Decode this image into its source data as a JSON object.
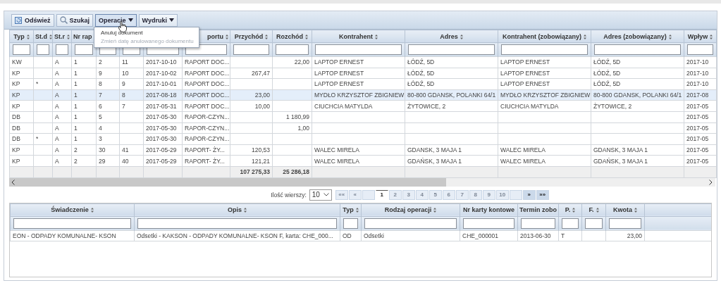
{
  "toolbar": {
    "buttons": [
      {
        "label": "Odśwież",
        "kind": "refresh"
      },
      {
        "label": "Szukaj",
        "kind": "search"
      },
      {
        "label": "Operacje",
        "kind": "menu",
        "selected": true
      },
      {
        "label": "Wydruki",
        "kind": "menu",
        "selected": false
      }
    ]
  },
  "menu": {
    "items": [
      {
        "label": "Anuluj dokument",
        "disabled": false
      },
      {
        "label": "Zmień datę anulowanego dokumentu",
        "disabled": true
      }
    ]
  },
  "documents_table": {
    "columns": [
      {
        "label": "Typ"
      },
      {
        "label": "St.d"
      },
      {
        "label": "St.r"
      },
      {
        "label": "Nr rap"
      },
      {},
      {},
      {},
      {
        "label": "portu"
      },
      {
        "label": "Przychód"
      },
      {
        "label": "Rozchód"
      },
      {
        "label": "Kontrahent"
      },
      {
        "label": "Adres"
      },
      {
        "label": "Kontrahent (zobowiązany)"
      },
      {
        "label": "Adres (zobowiązany)"
      },
      {
        "label": "Wpływ"
      }
    ],
    "rows": [
      {
        "selected": false,
        "cells": [
          "KW",
          null,
          "A",
          "1",
          "2",
          "11",
          "2017-10-10",
          "RAPORT DOC...",
          null,
          "22,00",
          "LAPTOP ERNEST",
          "ŁÓDŹ, 5D",
          "LAPTOP ERNEST",
          "ŁÓDŹ, 5D",
          "2017-10"
        ]
      },
      {
        "selected": false,
        "cells": [
          "KP",
          null,
          "A",
          "1",
          "9",
          "10",
          "2017-10-02",
          "RAPORT DOC...",
          "267,47",
          null,
          "LAPTOP ERNEST",
          "ŁÓDŹ, 5D",
          "LAPTOP ERNEST",
          "ŁÓDŹ, 5D",
          "2017-10"
        ]
      },
      {
        "selected": false,
        "cells": [
          "KP",
          "*",
          "A",
          "1",
          "8",
          "9",
          "2017-10-01",
          "RAPORT DOC...",
          null,
          null,
          "LAPTOP ERNEST",
          "ŁÓDŹ, 5D",
          "LAPTOP ERNEST",
          "ŁÓDŹ, 5D",
          "2017-10"
        ]
      },
      {
        "selected": true,
        "cells": [
          "KP",
          null,
          "A",
          "1",
          "7",
          "8",
          "2017-08-18",
          "RAPORT DOC...",
          "23,00",
          null,
          "MYDŁO KRZYSZTOF ZBIGNIEW",
          "80-800 GDANSK, POLANKI 64/1",
          "MYDŁO KRZYSZTOF ZBIGNIEW",
          "80-800 GDANSK, POLANKI 64/1",
          "2017-08"
        ]
      },
      {
        "selected": false,
        "cells": [
          "KP",
          null,
          "A",
          "1",
          "6",
          "7",
          "2017-05-31",
          "RAPORT DOC...",
          "10,00",
          null,
          "CIUCHCIA MATYLDA",
          "ŻYTOWICE, 2",
          "CIUCHCIA MATYLDA",
          "ŻYTOWICE, 2",
          "2017-05"
        ]
      },
      {
        "selected": false,
        "cells": [
          "DB",
          null,
          "A",
          "1",
          "5",
          null,
          "2017-05-30",
          "RAPOR-CZYN...",
          null,
          "1 180,99",
          null,
          null,
          null,
          null,
          "2017-05"
        ]
      },
      {
        "selected": false,
        "cells": [
          "DB",
          null,
          "A",
          "1",
          "4",
          null,
          "2017-05-30",
          "RAPOR-CZYN...",
          null,
          "1,00",
          null,
          null,
          null,
          null,
          "2017-05"
        ]
      },
      {
        "selected": false,
        "cells": [
          "DB",
          "*",
          "A",
          "1",
          "3",
          null,
          "2017-05-30",
          "RAPOR-CZYN...",
          null,
          null,
          null,
          null,
          null,
          null,
          "2017-05"
        ]
      },
      {
        "selected": false,
        "cells": [
          "KP",
          null,
          "A",
          "2",
          "30",
          "41",
          "2017-05-29",
          "RAPORT- ŻY...",
          "120,53",
          null,
          "WALEC MIRELA",
          "GDANSK, 3 MAJA 1",
          "WALEC MIRELA",
          "GDANSK, 3 MAJA 1",
          "2017-05"
        ]
      },
      {
        "selected": false,
        "cells": [
          "KP",
          null,
          "A",
          "2",
          "29",
          "40",
          "2017-05-29",
          "RAPORT- ŻY...",
          "121,21",
          null,
          "WALEC MIRELA",
          "GDAŃSK, 3 MAJA 1",
          "WALEC MIRELA",
          "GDAŃSK, 3 MAJA 1",
          "2017-05"
        ]
      }
    ],
    "totals": {
      "income": "107 275,33",
      "expense": "25 286,18"
    }
  },
  "pagination": {
    "rows_label": "Ilość wierszy:",
    "rows_value": "10",
    "buttons": [
      {
        "label": "««",
        "disabled": true
      },
      {
        "label": "«",
        "disabled": true
      },
      {
        "disabled": true
      },
      {
        "label": "1",
        "selected": true,
        "disabled": false
      },
      {
        "label": "2",
        "selected": false,
        "disabled": true
      },
      {
        "label": "3",
        "selected": false,
        "disabled": true
      },
      {
        "label": "4",
        "selected": false,
        "disabled": true
      },
      {
        "label": "5",
        "selected": false,
        "disabled": true
      },
      {
        "label": "6",
        "selected": false,
        "disabled": true
      },
      {
        "label": "7",
        "selected": false,
        "disabled": true
      },
      {
        "label": "8",
        "selected": false,
        "disabled": true
      },
      {
        "label": "9",
        "selected": false,
        "disabled": true
      },
      {
        "label": "10",
        "selected": false,
        "disabled": true
      },
      {
        "disabled": true
      },
      {
        "label": "»",
        "disabled": false
      },
      {
        "label": "»»",
        "disabled": false
      }
    ]
  },
  "details_table": {
    "columns": [
      {
        "label": "Świadczenie"
      },
      {
        "label": "Opis"
      },
      {
        "label": "Typ"
      },
      {
        "label": "Rodzaj operacji"
      },
      {
        "label": "Nr karty kontowe",
        "sortable": false
      },
      {
        "label": "Termin zobo",
        "sortable": false
      },
      {
        "label": "P."
      },
      {
        "label": "F."
      },
      {
        "label": "Kwota"
      }
    ],
    "rows": [
      {
        "cells": [
          "EON - ODPADY KOMUNALNE- KSON",
          "Odsetki - KAKSON - ODPADY KOMUNALNE- KSON F, karta: CHE_000...",
          "OD",
          "Odsetki",
          "CHE_000001",
          "2013-06-30",
          "T",
          null,
          "23,00"
        ]
      }
    ]
  }
}
